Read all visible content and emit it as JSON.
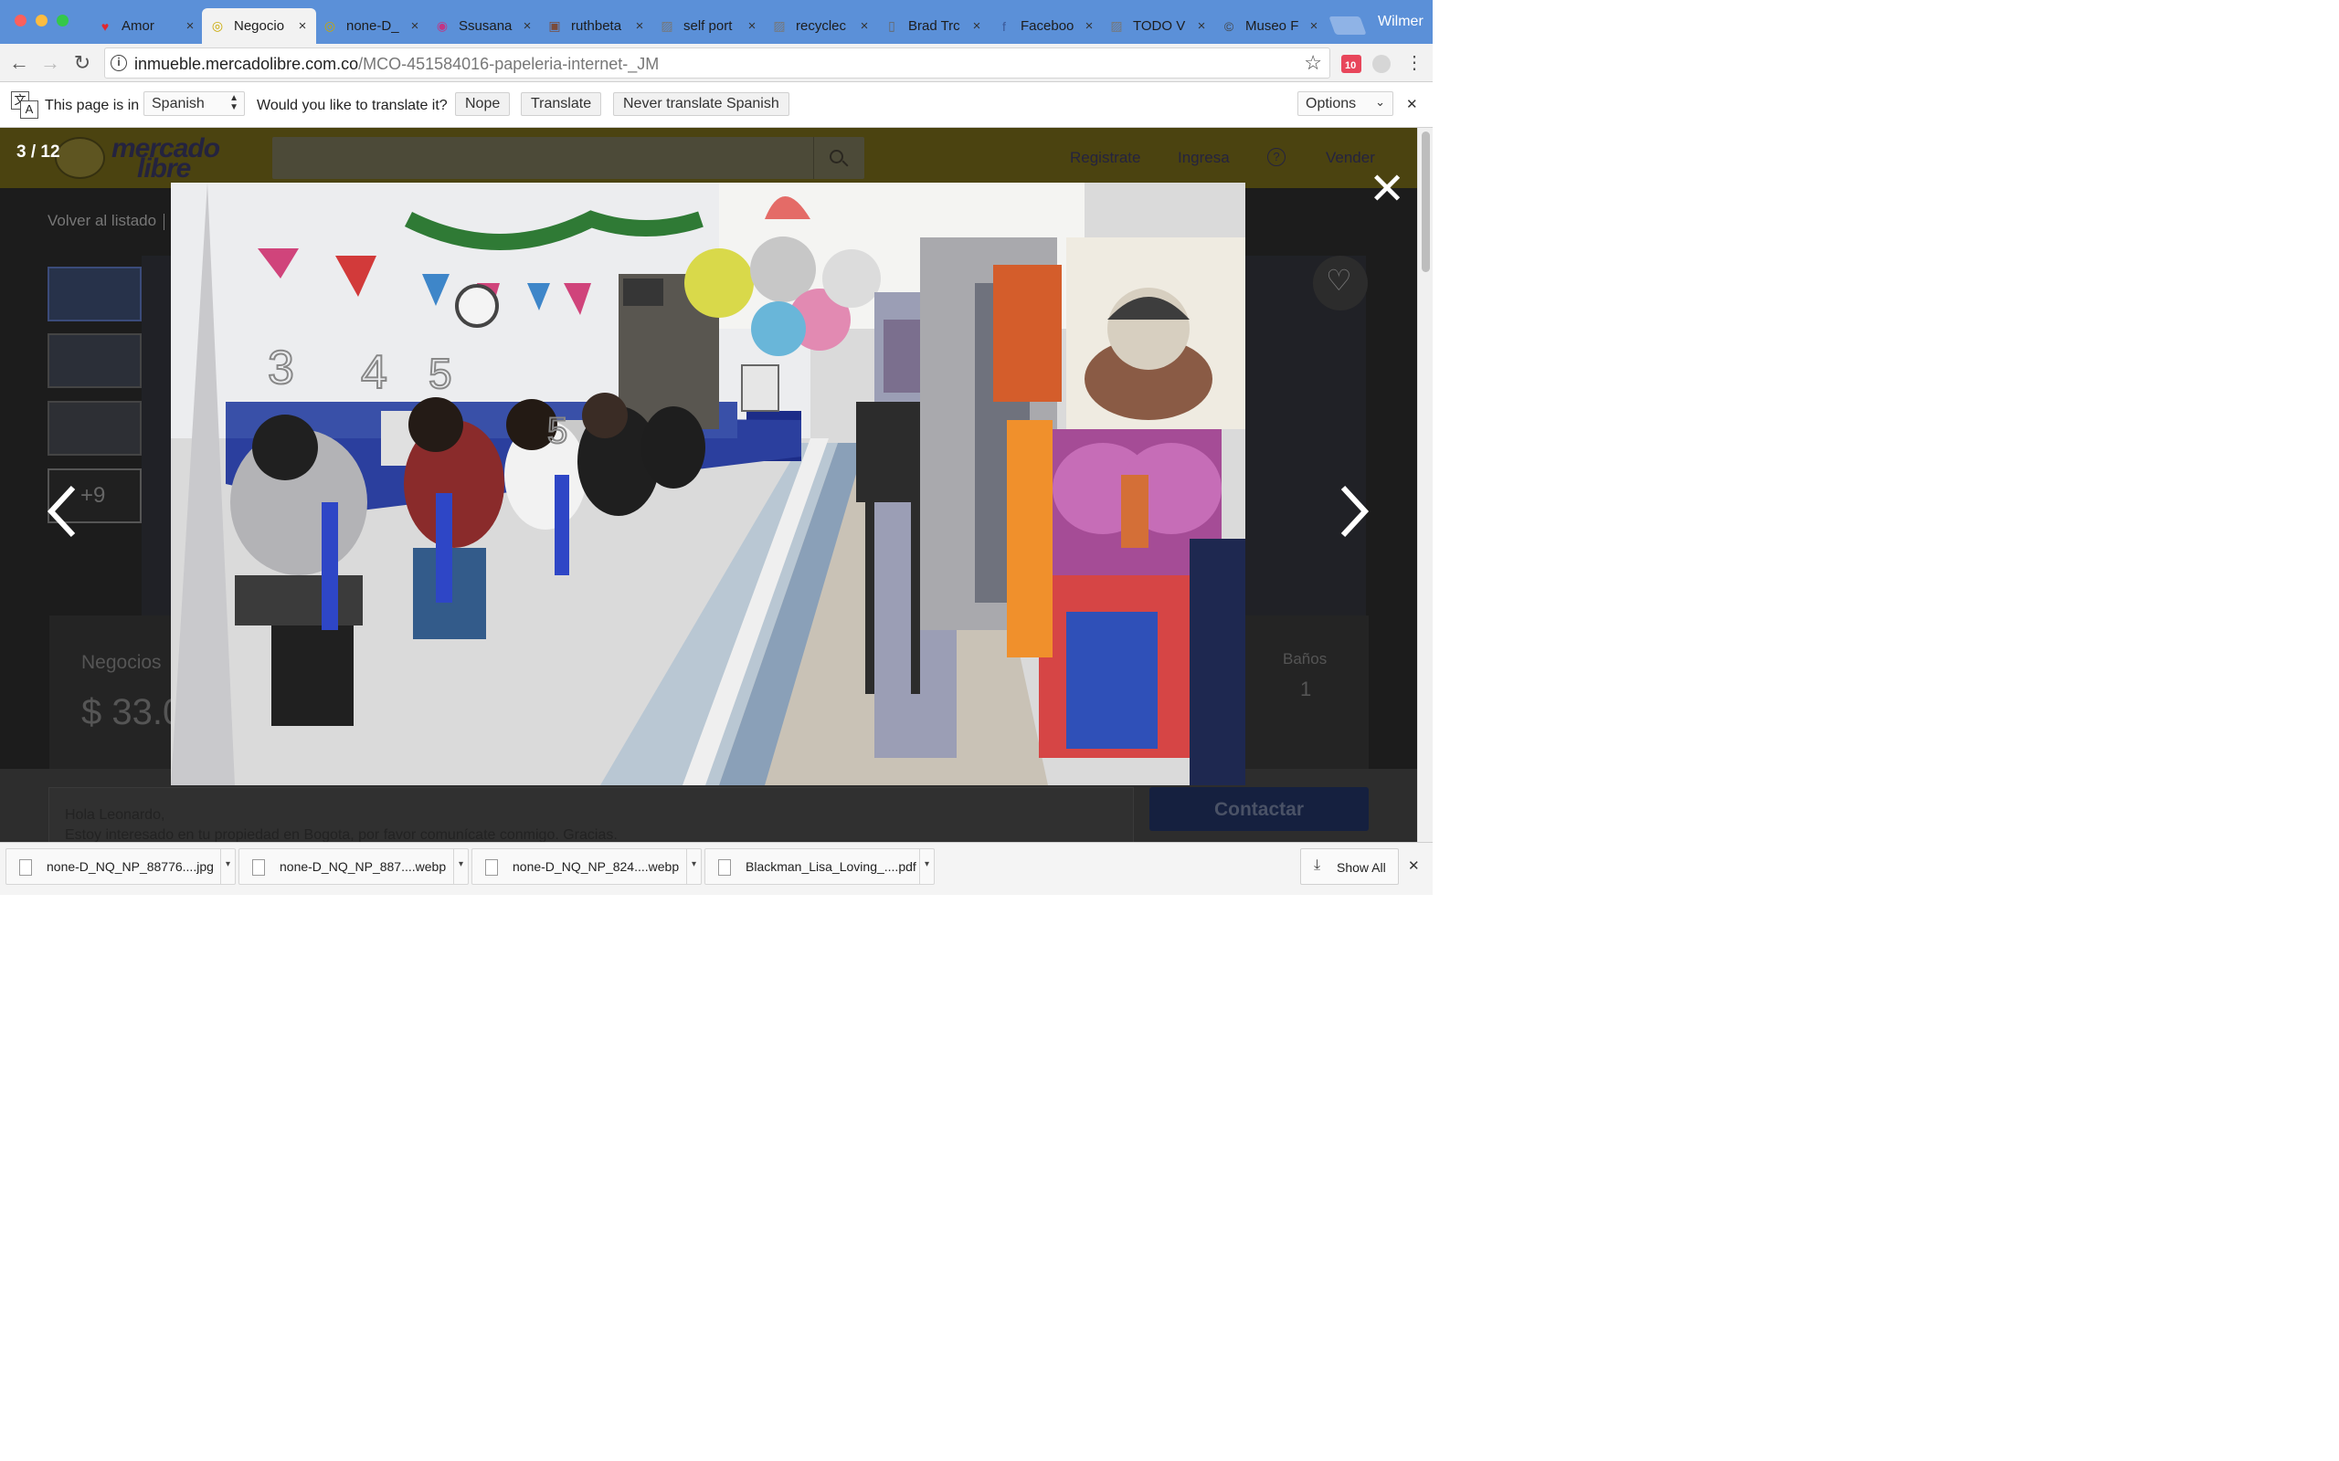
{
  "browser": {
    "profile_name": "Wilmer",
    "tabs": [
      {
        "title": "Amor",
        "icon": "heart-icon"
      },
      {
        "title": "Negocio",
        "icon": "mercadolibre-icon",
        "active": true
      },
      {
        "title": "none-D_",
        "icon": "mercadolibre-icon"
      },
      {
        "title": "Ssusana",
        "icon": "instagram-icon"
      },
      {
        "title": "ruthbeta",
        "icon": "photo-icon"
      },
      {
        "title": "self port",
        "icon": "image-icon"
      },
      {
        "title": "recyclec",
        "icon": "image-icon"
      },
      {
        "title": "Brad Trc",
        "icon": "document-icon"
      },
      {
        "title": "Faceboo",
        "icon": "facebook-icon"
      },
      {
        "title": "TODO V",
        "icon": "image-icon"
      },
      {
        "title": "Museo F",
        "icon": "copyright-icon"
      }
    ],
    "url_host": "inmueble.mercadolibre.com.co",
    "url_path": "/MCO-451584016-papeleria-internet-_JM",
    "extension_badge": "10"
  },
  "translate_bar": {
    "prefix": "This page is in",
    "language": "Spanish",
    "question": "Would you like to translate it?",
    "nope": "Nope",
    "translate": "Translate",
    "never": "Never translate Spanish",
    "options": "Options"
  },
  "ml": {
    "logo_top": "mercado",
    "logo_bottom": "libre",
    "nav": [
      "Registrate",
      "Ingresa",
      "Vender"
    ],
    "help": "?",
    "back": "Volver al listado",
    "more_photos": "+9",
    "category": "Negocios",
    "price": "$ 33.0",
    "banos_label": "Baños",
    "banos_value": "1",
    "message_line1": "Hola Leonardo,",
    "message_line2": "Estoy interesado en tu propiedad en Bogota, por favor comunícate conmigo. Gracias.",
    "contact_button": "Contactar"
  },
  "lightbox": {
    "counter": "3 / 12",
    "close": "✕",
    "desk_numbers": [
      "3",
      "4",
      "5",
      "5"
    ]
  },
  "downloads": {
    "items": [
      {
        "name": "none-D_NQ_NP_88776....jpg"
      },
      {
        "name": "none-D_NQ_NP_887....webp"
      },
      {
        "name": "none-D_NQ_NP_824....webp"
      },
      {
        "name": "Blackman_Lisa_Loving_....pdf"
      }
    ],
    "show_all": "Show All"
  },
  "colors": {
    "tabstrip": "#5b90d8",
    "ml_header": "#4b4310",
    "contact_button": "#15203f"
  }
}
